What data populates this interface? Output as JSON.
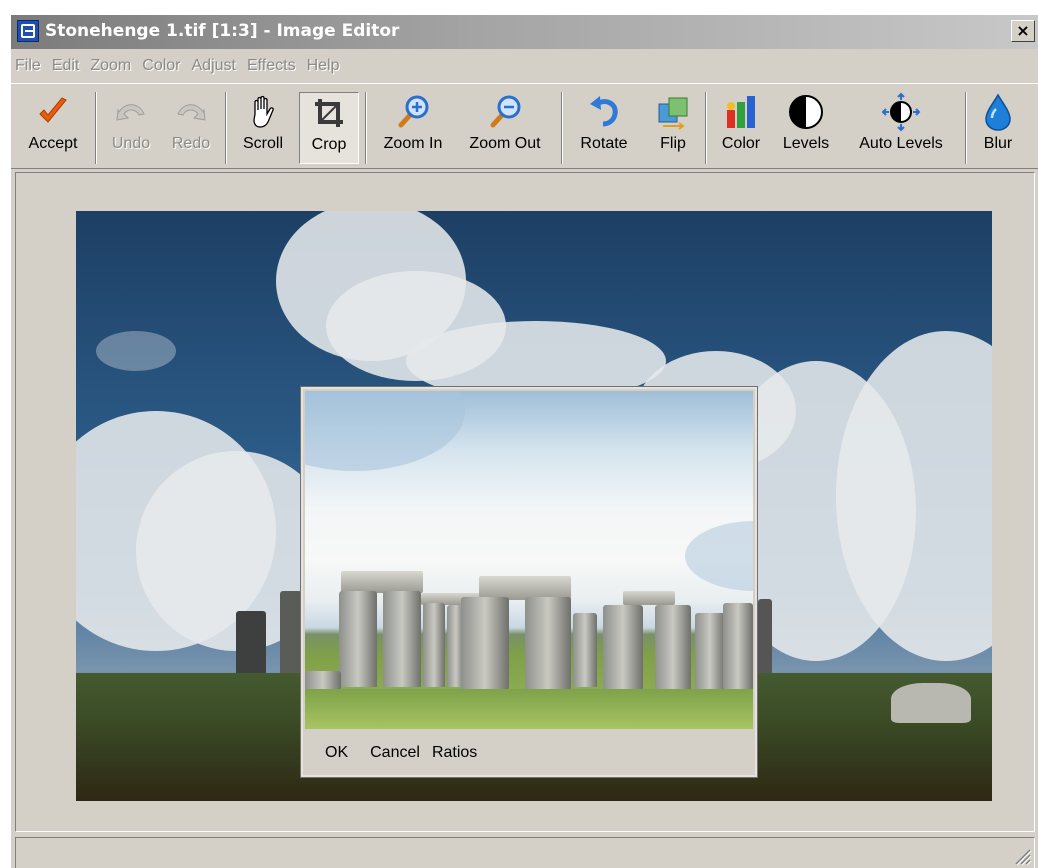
{
  "window": {
    "title": "Stonehenge 1.tif [1:3] - Image Editor",
    "close_label": "×"
  },
  "menu": [
    {
      "label": "File"
    },
    {
      "label": "Edit"
    },
    {
      "label": "Zoom"
    },
    {
      "label": "Color"
    },
    {
      "label": "Adjust"
    },
    {
      "label": "Effects"
    },
    {
      "label": "Help"
    }
  ],
  "toolbar": {
    "accept": "Accept",
    "undo": "Undo",
    "redo": "Redo",
    "scroll": "Scroll",
    "crop": "Crop",
    "zoom_in": "Zoom In",
    "zoom_out": "Zoom Out",
    "rotate": "Rotate",
    "flip": "Flip",
    "color": "Color",
    "levels": "Levels",
    "auto_levels": "Auto Levels",
    "blur": "Blur"
  },
  "crop_panel": {
    "ok": "OK",
    "cancel": "Cancel",
    "ratios": "Ratios"
  },
  "colors": {
    "face": "#d4d0c8",
    "accept_check": "#e85c10",
    "zoom_blue": "#2a6fd0",
    "rotate_blue": "#2f7ad8",
    "blur_drop": "#1e7fd8"
  }
}
